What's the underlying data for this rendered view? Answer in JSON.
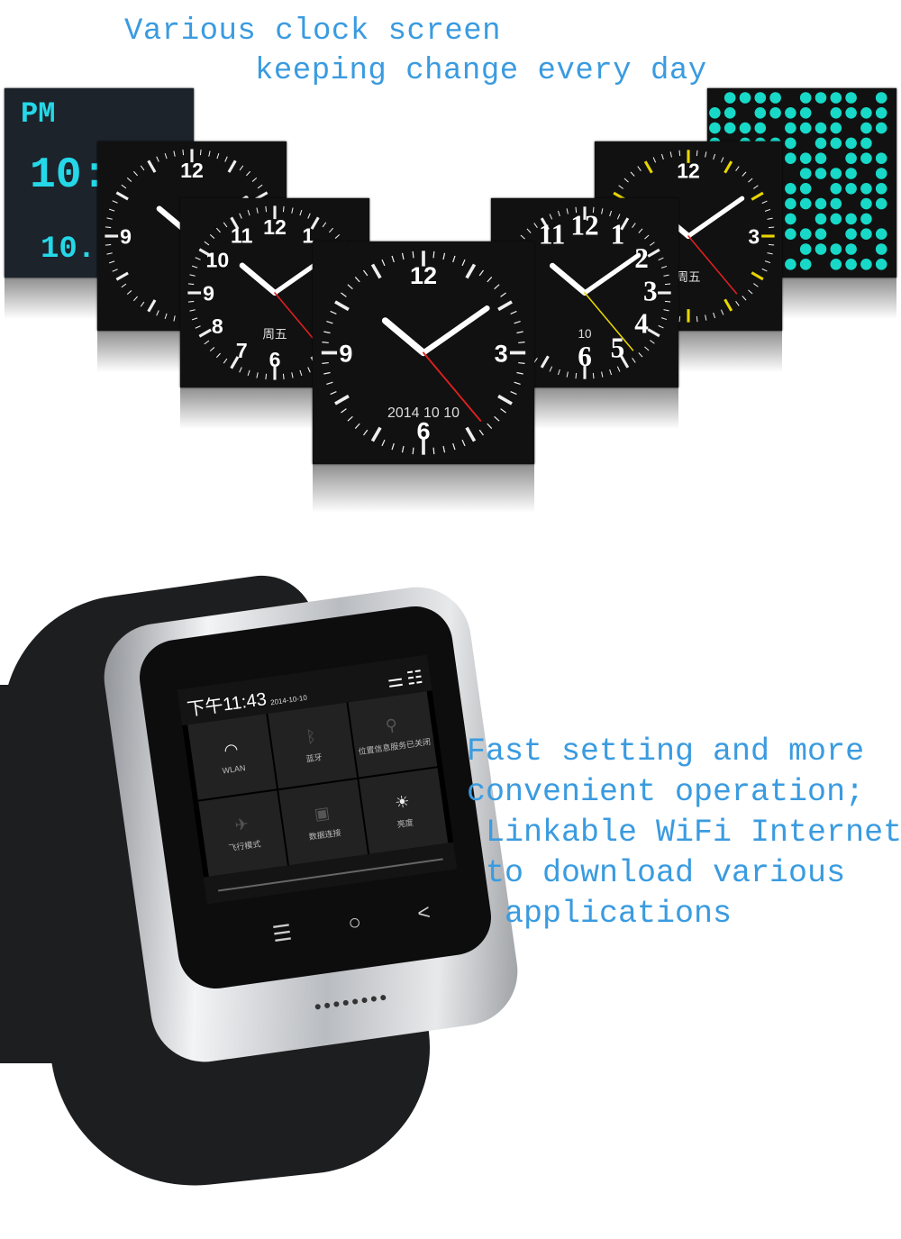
{
  "headline": {
    "line1": "Various clock screen",
    "line2": "keeping change every day",
    "color": "#3a9be0"
  },
  "clock_faces": [
    {
      "style": "digital",
      "lines": [
        "PM",
        "10:",
        "10."
      ],
      "color": "#25d8e8"
    },
    {
      "style": "analog-bold",
      "numerals": [
        "12",
        "9"
      ]
    },
    {
      "style": "analog-numbers",
      "numerals": [
        "11",
        "12",
        "1",
        "10",
        "9",
        "8",
        "7",
        "6"
      ],
      "day": "周五"
    },
    {
      "style": "analog-classic",
      "numerals": [
        "12",
        "3",
        "6",
        "9"
      ],
      "date": "2014 10 10"
    },
    {
      "style": "analog-serif",
      "numerals": [
        "11",
        "12",
        "1",
        "2",
        "3",
        "4",
        "5",
        "6"
      ],
      "date": "10"
    },
    {
      "style": "analog-sport",
      "numerals": [
        "12",
        "3"
      ],
      "day": "周五"
    },
    {
      "style": "dot-matrix",
      "color": "#18d9c8"
    }
  ],
  "watch": {
    "time": "下午11:43",
    "date": "2014-10-10",
    "tiles": [
      {
        "icon": "wifi-icon",
        "glyph": "◠",
        "label": "WLAN"
      },
      {
        "icon": "bluetooth-icon",
        "glyph": "ᛒ",
        "label": "蓝牙"
      },
      {
        "icon": "location-icon",
        "glyph": "⚲",
        "label": "位置信息服务已关闭"
      },
      {
        "icon": "airplane-icon",
        "glyph": "✈",
        "label": "飞行模式"
      },
      {
        "icon": "data-icon",
        "glyph": "▣",
        "label": "数据连接"
      },
      {
        "icon": "brightness-icon",
        "glyph": "☀",
        "label": "亮度"
      }
    ],
    "nav": {
      "menu": "☰",
      "home": "○",
      "back": "<"
    },
    "toolbar": {
      "settings": "⚌",
      "list": "☷"
    }
  },
  "copy": {
    "lines": [
      "Fast setting and more",
      "convenient operation;",
      " Linkable WiFi Internet",
      " to download various",
      "  applications"
    ]
  }
}
